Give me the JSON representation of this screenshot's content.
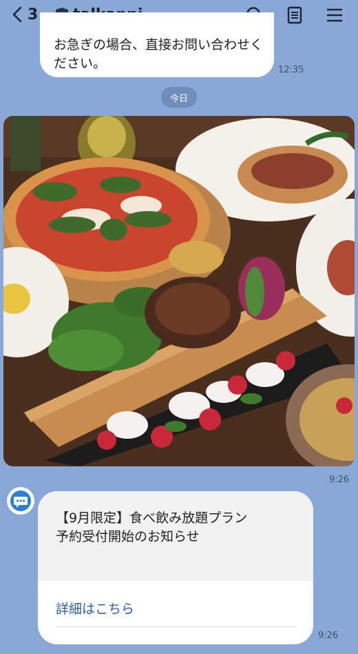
{
  "header": {
    "back_count": "3",
    "title": "talkappi"
  },
  "messages": {
    "top_bubble_text": "お急ぎの場合、直接お問い合わせください。",
    "top_time": "12:35",
    "date_label": "今日",
    "photo_time": "9:26",
    "card_title_line1": "【9月限定】食べ飲み放題プラン",
    "card_title_line2": "予約受付開始のお知らせ",
    "card_link": "詳細はこちら",
    "card_time": "9:26"
  },
  "colors": {
    "background": "#8aa8d6",
    "link": "#2b5fa8",
    "date_chip": "#6f8dbc"
  },
  "icons": [
    "chevron-left-icon",
    "shield-icon",
    "search-icon",
    "notes-icon",
    "menu-icon",
    "chat-avatar-icon"
  ]
}
